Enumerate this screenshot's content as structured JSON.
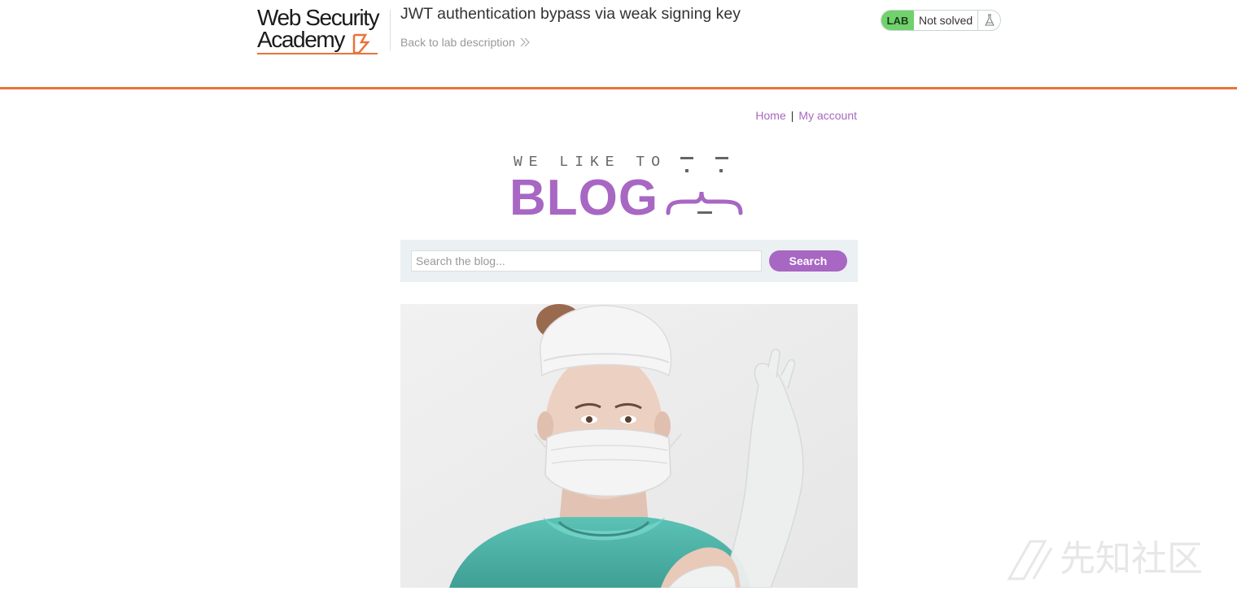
{
  "academy_header": {
    "logo_line1": "Web Security",
    "logo_line2": "Academy",
    "lab_title": "JWT authentication bypass via weak signing key",
    "back_link": "Back to lab description",
    "lab_badge": "LAB",
    "lab_state": "Not solved",
    "accent_color": "#e8733a",
    "badge_color": "#70d16d"
  },
  "nav": {
    "home": "Home",
    "separator": "|",
    "my_account": "My account"
  },
  "blog_logo": {
    "tagline": "WE LIKE TO",
    "wordmark": "BLOG",
    "brand_color": "#a767c3"
  },
  "search": {
    "placeholder": "Search the blog...",
    "value": "",
    "button_label": "Search"
  },
  "post": {
    "image_icon": "nurse-surgical-mask-photo"
  },
  "watermark": {
    "text": "先知社区"
  }
}
